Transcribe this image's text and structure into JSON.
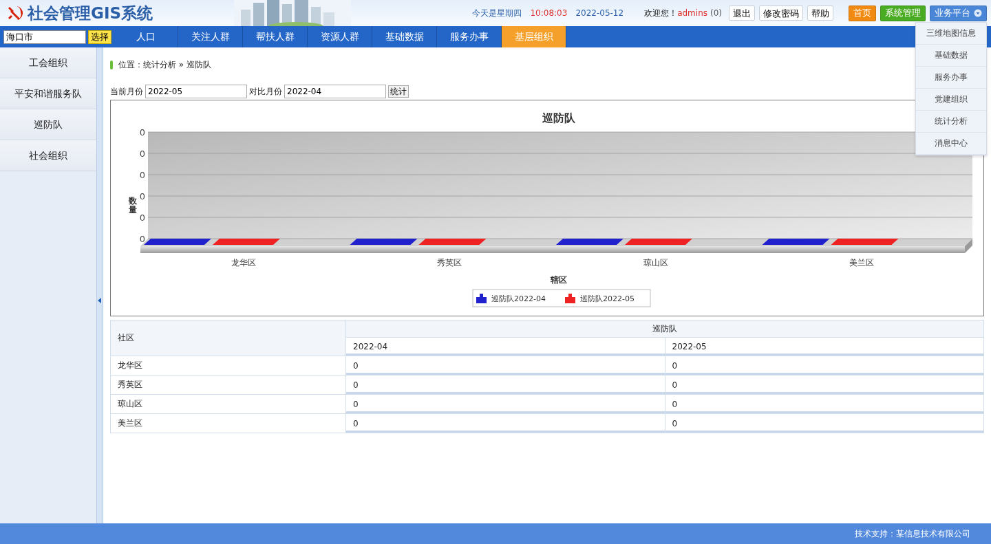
{
  "header": {
    "title": "社会管理GIS系统",
    "day": "今天是星期四",
    "time": "10:08:03",
    "date": "2022-05-12",
    "welcome": "欢迎您！",
    "user": "admins",
    "count": "(0)",
    "buttons": [
      "退出",
      "修改密码",
      "帮助"
    ],
    "nav_buttons": [
      {
        "label": "首页",
        "kind": "home"
      },
      {
        "label": "系统管理",
        "kind": "admin"
      },
      {
        "label": "业务平台",
        "kind": "platform"
      }
    ]
  },
  "city": {
    "field": {
      "value": "海口市"
    },
    "button": "选择"
  },
  "tabs": [
    {
      "label": "人口",
      "selected": false
    },
    {
      "label": "关注人群",
      "selected": false
    },
    {
      "label": "帮扶人群",
      "selected": false
    },
    {
      "label": "资源人群",
      "selected": false
    },
    {
      "label": "基础数据",
      "selected": false
    },
    {
      "label": "服务办事",
      "selected": false
    },
    {
      "label": "基层组织",
      "selected": true
    }
  ],
  "platform_menu": [
    "三维地图信息",
    "基础数据",
    "服务办事",
    "党建组织",
    "统计分析",
    "消息中心"
  ],
  "sidebar": {
    "items": [
      "工会组织",
      "平安和谐服务队",
      "巡防队",
      "社会组织"
    ]
  },
  "breadcrumb": "位置：统计分析 » 巡防队",
  "filters": {
    "current_label": "当前月份",
    "current_value": "2022-05",
    "compare_label": "对比月份",
    "compare_value": "2022-04",
    "button": "统计"
  },
  "chart": {
    "title": "巡防队",
    "y_axis_title": "数量",
    "y_axis_labels": [
      "0",
      "0",
      "0",
      "0",
      "0",
      "0"
    ],
    "categories": [
      "龙华区",
      "秀英区",
      "琼山区",
      "美兰区"
    ],
    "x_axis_title": "辖区",
    "legend": [
      {
        "name": "巡防队2022-04",
        "color": "#2222cc"
      },
      {
        "name": "巡防队2022-05",
        "color": "#ee2222"
      }
    ]
  },
  "table": {
    "first_column": "社区",
    "group": "巡防队",
    "columns": [
      "2022-04",
      "2022-05"
    ],
    "rows": [
      {
        "name": "龙华区",
        "values": [
          "0",
          "0"
        ]
      },
      {
        "name": "秀英区",
        "values": [
          "0",
          "0"
        ]
      },
      {
        "name": "琼山区",
        "values": [
          "0",
          "0"
        ]
      },
      {
        "name": "美兰区",
        "values": [
          "0",
          "0"
        ]
      }
    ]
  },
  "footer": "技术支持：某信息技术有限公司"
}
